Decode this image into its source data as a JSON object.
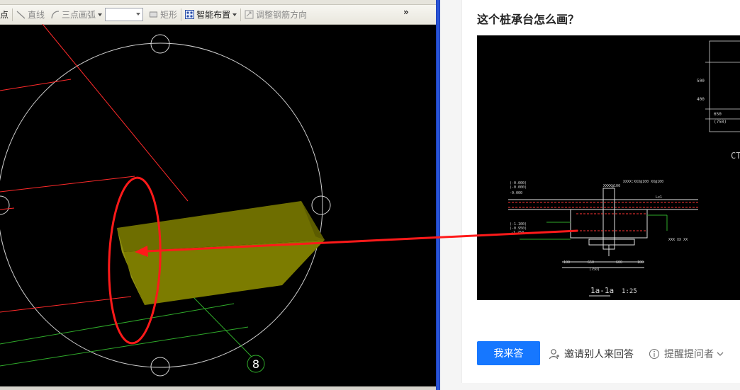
{
  "cad_toolbar": {
    "partial_label": "点",
    "line_label": "直线",
    "arc_label": "三点画弧",
    "rect_label": "矩形",
    "smart_layout_label": "智能布置",
    "adjust_rebar_label": "调整钢筋方向",
    "overflow_label": "»"
  },
  "cad_view": {
    "axis_marker": "8",
    "colors": {
      "background": "#000000",
      "pile_cap_face": "#7a7a00",
      "pile_cap_side": "#8f8f0a",
      "red_lines": "#ff2a2a",
      "green_lines": "#2faa2a",
      "annotation": "#ff1a1a"
    }
  },
  "question": {
    "title": "这个桩承台怎么画？",
    "image_labels": {
      "section_title": "1a-1a",
      "scale": "1:25",
      "side_label": "CT"
    }
  },
  "actions": {
    "answer_button": "我来答",
    "invite_label": "邀请别人来回答",
    "remind_label": "提醒提问者"
  },
  "icons": [
    "line-icon",
    "arc-icon",
    "rect-icon",
    "smart-layout-icon",
    "adjust-rebar-icon",
    "invite-user-icon",
    "info-icon",
    "chevron-down-icon"
  ]
}
